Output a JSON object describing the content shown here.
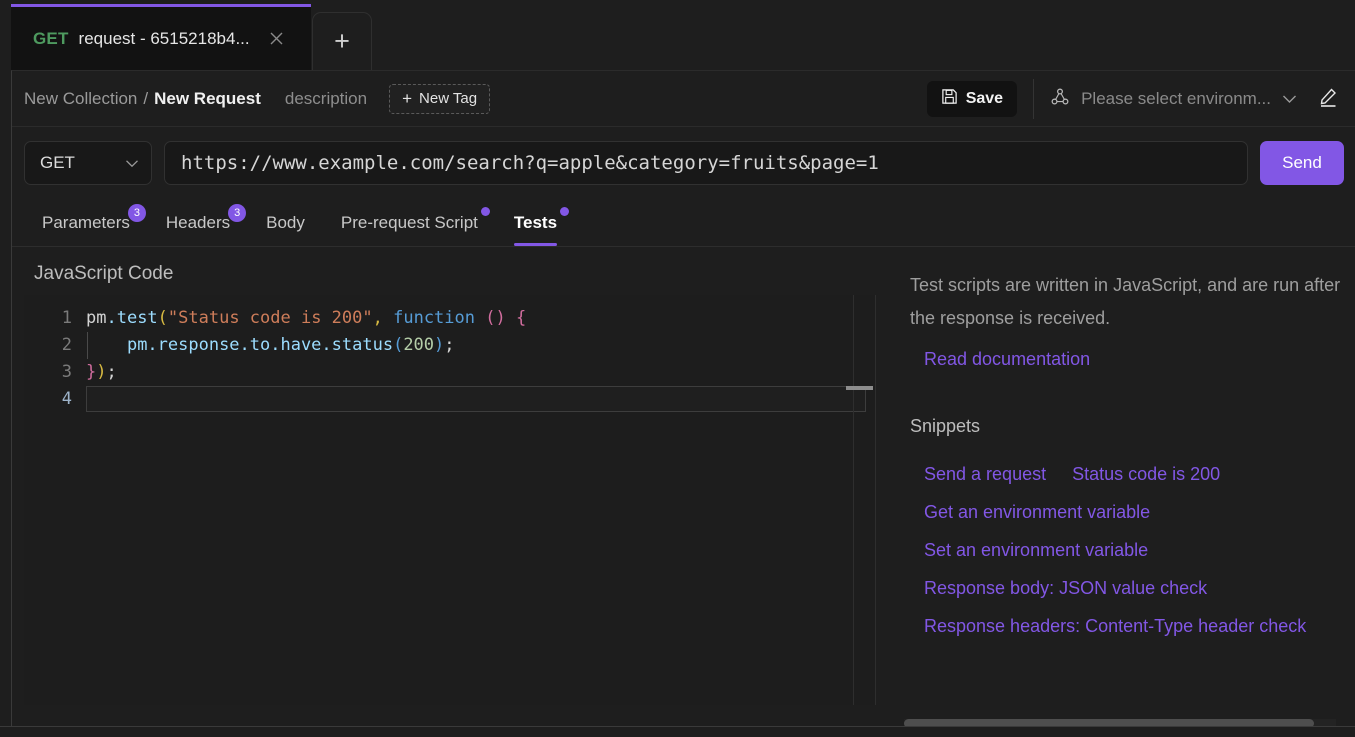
{
  "tab": {
    "method": "GET",
    "title": "request - 6515218b4...",
    "close_icon": "close-icon",
    "new_tab_label": "+"
  },
  "breadcrumb": {
    "collection": "New Collection",
    "separator": "/",
    "request": "New Request",
    "description": "description",
    "new_tag_plus": "+",
    "new_tag_label": "New Tag"
  },
  "toolbar": {
    "save_label": "Save",
    "environment_placeholder": "Please select environm...",
    "chevron": "∨",
    "edit_icon": "pencil-icon"
  },
  "request": {
    "method": "GET",
    "method_chevron": "∨",
    "url": "https://www.example.com/search?q=apple&category=fruits&page=1",
    "send_label": "Send"
  },
  "tabs": [
    {
      "label": "Parameters",
      "badge": "3",
      "dot": false,
      "active": false
    },
    {
      "label": "Headers",
      "badge": "3",
      "dot": false,
      "active": false
    },
    {
      "label": "Body",
      "badge": "",
      "dot": false,
      "active": false
    },
    {
      "label": "Pre-request Script",
      "badge": "",
      "dot": true,
      "active": false
    },
    {
      "label": "Tests",
      "badge": "",
      "dot": true,
      "active": true
    }
  ],
  "editor": {
    "section_title": "JavaScript Code",
    "line_numbers": [
      "1",
      "2",
      "3",
      "4"
    ],
    "code_lines": [
      "pm.test(\"Status code is 200\", function () {",
      "    pm.response.to.have.status(200);",
      "});",
      ""
    ],
    "line1": {
      "pm": "pm",
      "dot_test": ".test",
      "open_paren": "(",
      "string": "\"Status code is 200\"",
      "comma": ", ",
      "keyword": "function",
      "space": " ",
      "parens": "()",
      "space2": " ",
      "brace": "{"
    },
    "line2": {
      "indent": "    ",
      "chain": "pm.response.to.have.status",
      "open_paren": "(",
      "number": "200",
      "close_paren": ")",
      "semicolon": ";"
    },
    "line3": {
      "brace": "}",
      "close_paren": ")",
      "semicolon": ";"
    }
  },
  "help": {
    "description": "Test scripts are written in JavaScript, and are run after the response is received.",
    "documentation_link": "Read documentation",
    "snippets_title": "Snippets",
    "snippets": [
      "Send a request",
      "Status code is 200",
      "Get an environment variable",
      "Set an environment variable",
      "Response body: JSON value check",
      "Response headers: Content-Type header check"
    ]
  },
  "colors": {
    "accent": "#8257e5",
    "method_get": "#4e9a5f",
    "background": "#1e1e1e",
    "editor_bg": "#1d1d1d",
    "link": "#8257e5"
  }
}
